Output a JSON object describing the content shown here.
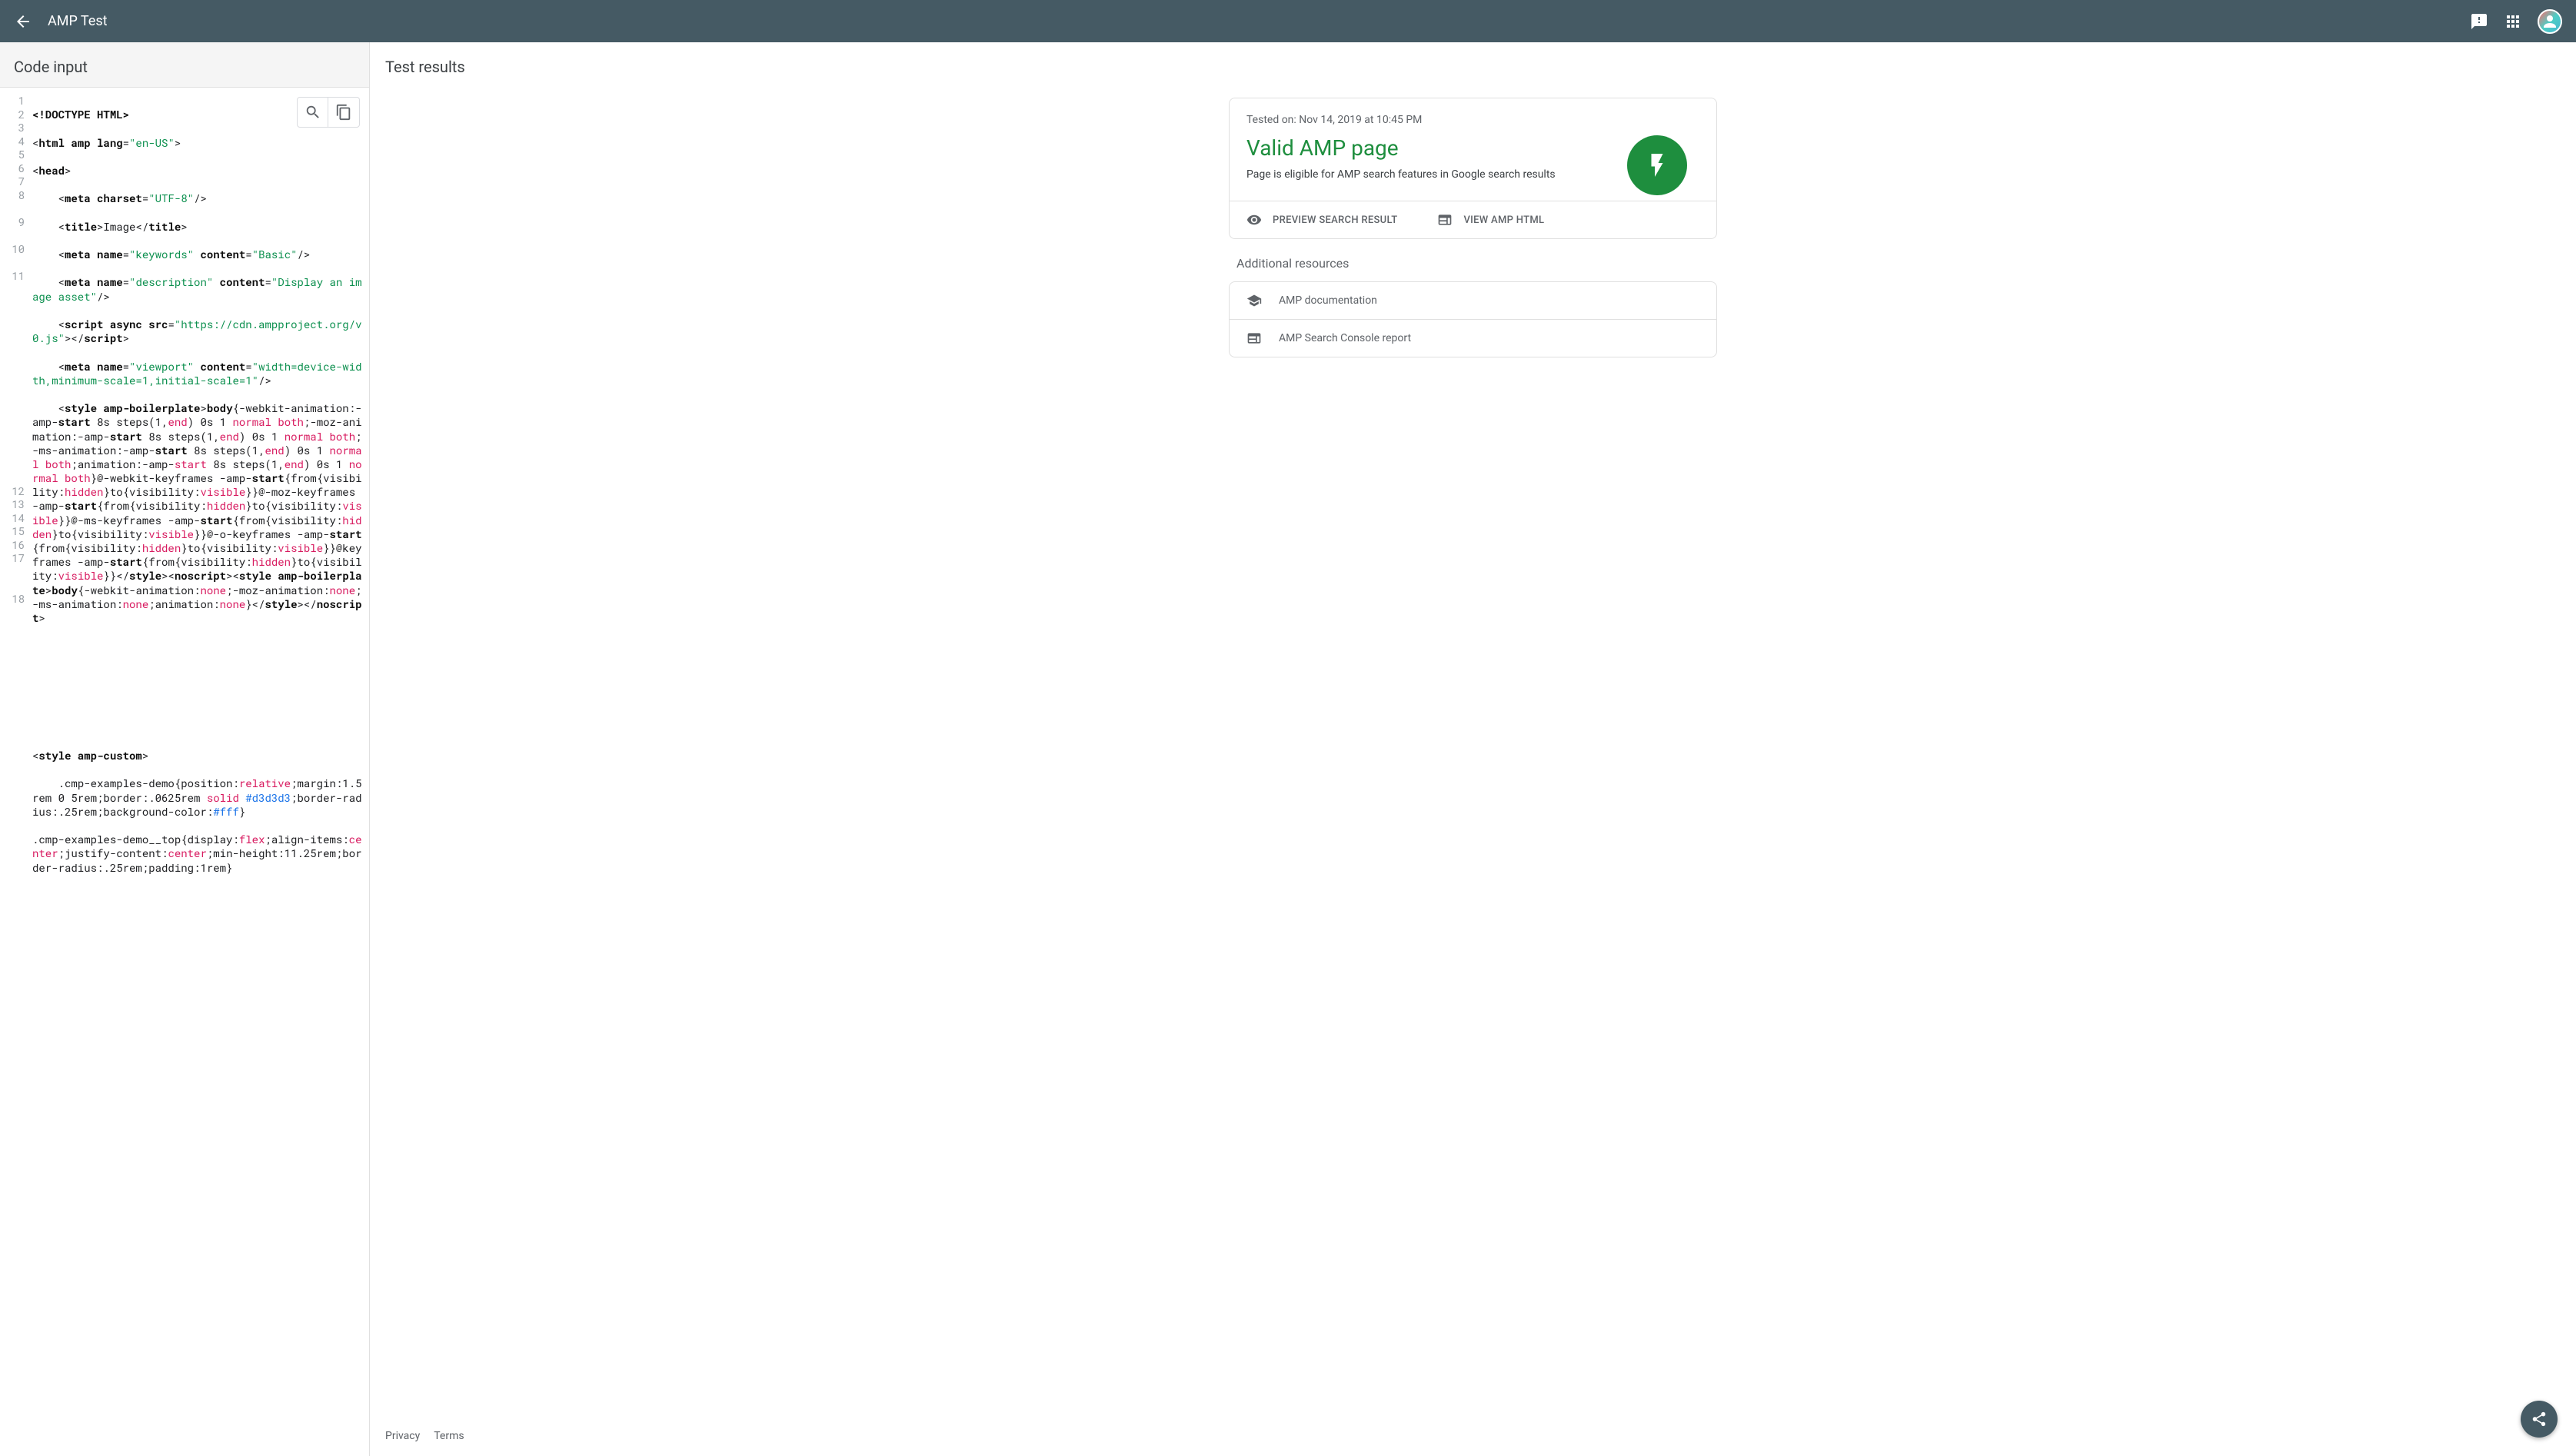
{
  "header": {
    "title": "AMP Test"
  },
  "leftPanel": {
    "title": "Code input"
  },
  "codeLines": {
    "gutters": [
      "1",
      "2",
      "3",
      "4",
      "5",
      "6",
      "7",
      "8",
      "",
      "9",
      "",
      "10",
      "",
      "11",
      "",
      "",
      "",
      "",
      "",
      "",
      "",
      "",
      "",
      "",
      "",
      "",
      "",
      "",
      "",
      "12",
      "13",
      "14",
      "15",
      "16",
      "17",
      "",
      "",
      "18",
      ""
    ]
  },
  "rightPanel": {
    "title": "Test results",
    "testedOn": "Tested on: Nov 14, 2019 at 10:45 PM",
    "validTitle": "Valid AMP page",
    "validSub": "Page is eligible for AMP search features in Google search results",
    "actionPreview": "PREVIEW SEARCH RESULT",
    "actionView": "VIEW AMP HTML",
    "additionalTitle": "Additional resources",
    "resDoc": "AMP documentation",
    "resReport": "AMP Search Console report"
  },
  "footer": {
    "privacy": "Privacy",
    "terms": "Terms"
  },
  "code": {
    "l1": "<!DOCTYPE HTML>",
    "l2a": "<",
    "l2b": "html amp lang",
    "l2c": "=",
    "l2d": "\"en-US\"",
    "l2e": ">",
    "l3a": "<",
    "l3b": "head",
    "l3c": ">",
    "l4a": "    <",
    "l4b": "meta charset",
    "l4c": "=",
    "l4d": "\"UTF-8\"",
    "l4e": "/>",
    "l5a": "    <",
    "l5b": "title",
    "l5c": ">Image</",
    "l5d": "title",
    "l5e": ">",
    "l6a": "    <",
    "l6b": "meta name",
    "l6c": "=",
    "l6d": "\"keywords\"",
    "l6e": " ",
    "l6f": "content",
    "l6g": "=",
    "l6h": "\"Basic\"",
    "l6i": "/>",
    "l7a": "    <",
    "l7b": "meta name",
    "l7c": "=",
    "l7d": "\"description\"",
    "l7e": " ",
    "l7f": "content",
    "l7g": "=",
    "l7h": "\"Display an image asset\"",
    "l7i": "/>",
    "l9a": "    <",
    "l9b": "script async src",
    "l9c": "=",
    "l9d": "\"https://cdn.ampproject.org/v0.js\"",
    "l9e": "></",
    "l9f": "script",
    "l9g": ">",
    "l10a": "    <",
    "l10b": "meta name",
    "l10c": "=",
    "l10d": "\"viewport\"",
    "l10e": " ",
    "l10f": "content",
    "l10g": "=",
    "l10h": "\"width=device-width,minimum-scale=1,initial-scale=1\"",
    "l10i": "/>",
    "l11a": "    <",
    "l11b": "style amp-boilerplate",
    "l11c": ">",
    "l11d": "body",
    "l11e": "{-webkit-animation:-amp-",
    "l11start": "start",
    "l11mid1": " 8s steps(1,",
    "l11end": "end",
    "l11mid2": ") 0s 1 ",
    "l11normal": "normal",
    "l11sp": " ",
    "l11both": "both",
    "l11moz": ";-moz-animation:-amp-",
    "l11ms": ";-ms-animation:-amp-",
    "l11anim": ";animation:-amp-",
    "l11wkf": "}@-webkit-keyframes -amp-",
    "l11from": "{from{visibility:",
    "l11hidden": "hidden",
    "l11to": "}to{visibility:",
    "l11visible": "visible",
    "l11cb": "}}",
    "l11mozkf": "@-moz-keyframes -amp-",
    "l11mskf": "@-ms-keyframes -amp-",
    "l11okf": "@-o-keyframes -amp-",
    "l11kf": "@keyframes -amp-",
    "l11close1": "</",
    "l11style": "style",
    "l11close2": "><",
    "l11noscript": "noscript",
    "l11close3": "><",
    "l11sab": "style amp-boilerplate",
    "l11wa": "{-webkit-animation:",
    "l11none": "none",
    "l11ma": ";-moz-animation:",
    "l11msa": ";-ms-animation:",
    "l11aa": ";animation:",
    "l11cc": "}</",
    "l11nss": "noscript",
    "l11end2": ">",
    "l16a": "<",
    "l16b": "style amp-custom",
    "l16c": ">",
    "l17a": "    .cmp-examples-demo{position:",
    "l17b": "relative",
    "l17c": ";margin:1.5rem 0 5rem;border:.0625rem ",
    "l17d": "solid",
    "l17e": " ",
    "l17f": "#d3d3d3",
    "l17g": ";border-radius:.25rem;background-color:",
    "l17h": "#fff",
    "l17i": "}",
    "l18a": ".cmp-examples-demo__top{display:",
    "l18b": "flex",
    "l18c": ";align-items:",
    "l18d": "center",
    "l18e": ";justify-content:",
    "l18f": "center",
    "l18g": ";min-height:11.25rem;border-radius:.25rem;padding:1rem}"
  }
}
